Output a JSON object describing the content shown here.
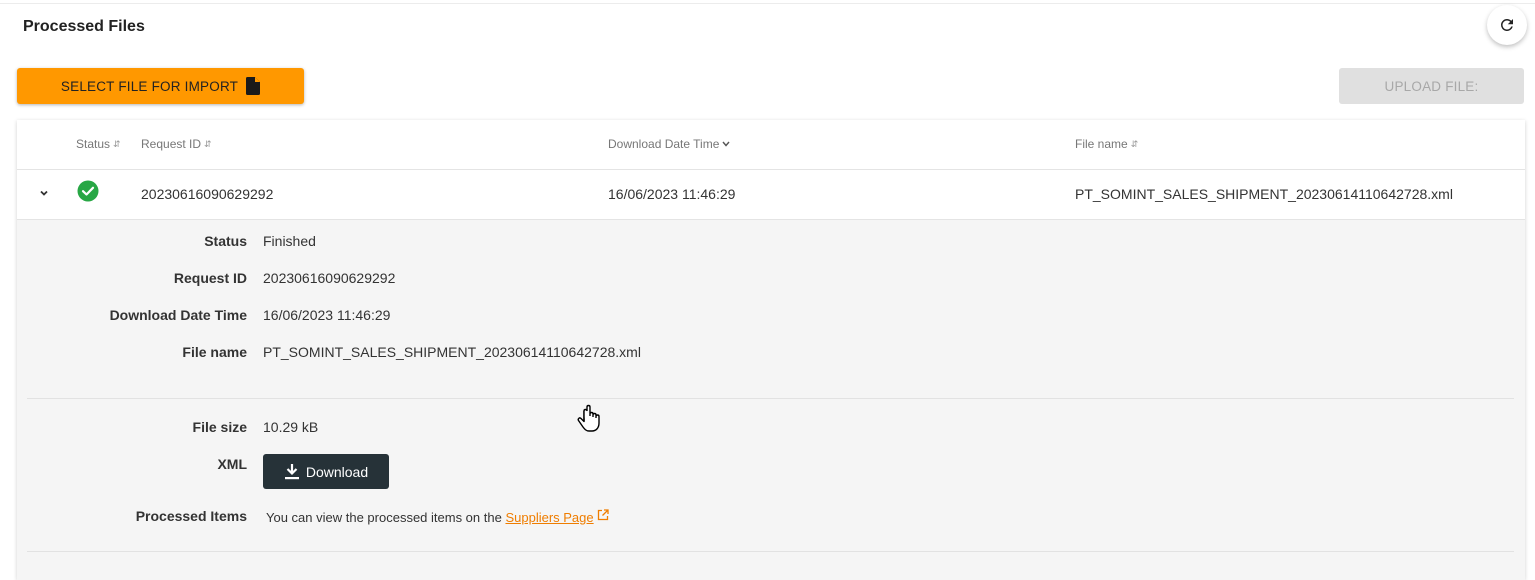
{
  "page": {
    "title": "Processed Files"
  },
  "toolbar": {
    "select_label": "SELECT FILE FOR IMPORT",
    "upload_label": "UPLOAD FILE:",
    "refresh_icon": "refresh-icon"
  },
  "table": {
    "columns": [
      {
        "label": "Status",
        "sort": "unsorted"
      },
      {
        "label": "Request ID",
        "sort": "unsorted"
      },
      {
        "label": "Download Date Time",
        "sort": "descending"
      },
      {
        "label": "File name",
        "sort": "unsorted"
      }
    ],
    "rows": [
      {
        "status": "Finished",
        "status_icon": "check-circle-icon",
        "request_id": "20230616090629292",
        "download_date_time": "16/06/2023 11:46:29",
        "file_name": "PT_SOMINT_SALES_SHIPMENT_20230614110642728.xml",
        "expanded": true
      }
    ]
  },
  "detail": {
    "status_label": "Status",
    "status_value": "Finished",
    "request_id_label": "Request ID",
    "request_id_value": "20230616090629292",
    "download_label": "Download Date Time",
    "download_value": "16/06/2023 11:46:29",
    "file_name_label": "File name",
    "file_name_value": "PT_SOMINT_SALES_SHIPMENT_20230614110642728.xml",
    "file_size_label": "File size",
    "file_size_value": "10.29 kB",
    "xml_label": "XML",
    "download_button": "Download",
    "processed_label": "Processed Items",
    "processed_text": "You can view the processed items on the",
    "suppliers_link": "Suppliers Page"
  },
  "colors": {
    "accent": "#ff9800",
    "link": "#ef7d00",
    "success": "#28a745",
    "dark_button": "#263238",
    "disabled": "#e0e0e0"
  }
}
